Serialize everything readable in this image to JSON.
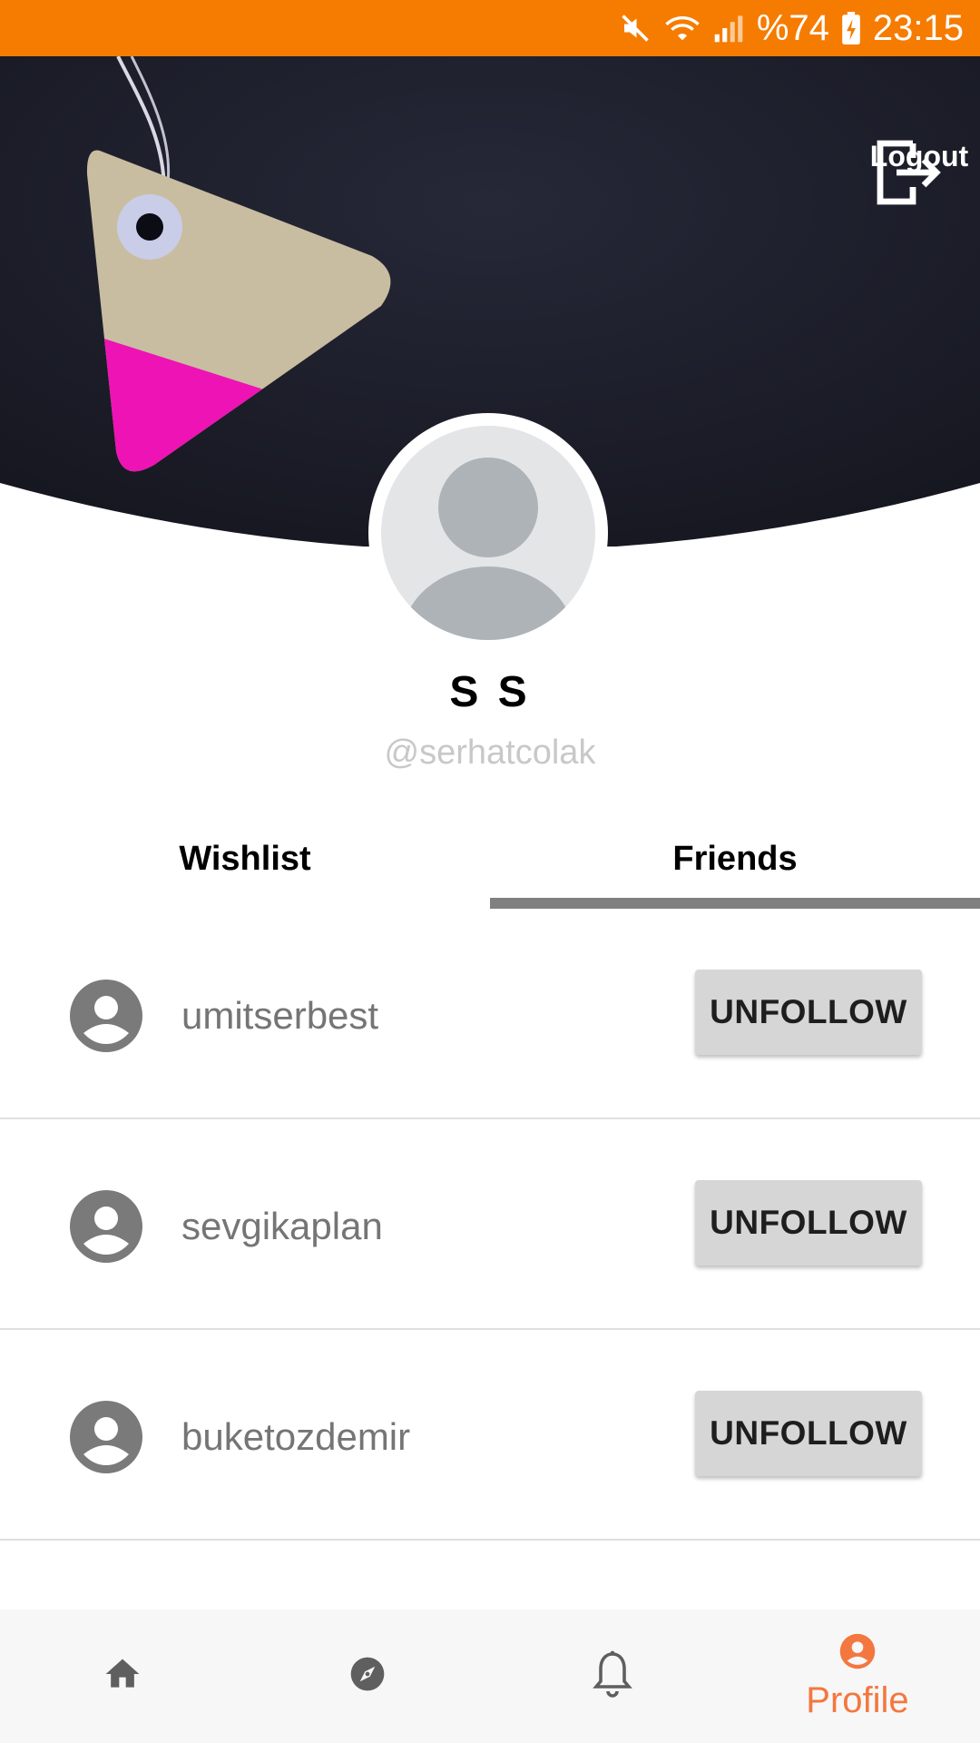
{
  "status_bar": {
    "icons": [
      "mute-icon",
      "wifi-icon",
      "signal-icon",
      "battery-charging-icon"
    ],
    "battery": "%74",
    "time": "23:15",
    "background_color": "#f57c00"
  },
  "header": {
    "logout_label": "Logout",
    "logout_icon": "logout-icon",
    "background_color": "#1b1d2a"
  },
  "profile": {
    "avatar_icon": "default-avatar-icon",
    "name": "S S",
    "handle": "@serhatcolak"
  },
  "tabs": [
    {
      "label": "Wishlist",
      "active": false
    },
    {
      "label": "Friends",
      "active": true
    }
  ],
  "friends": [
    {
      "username": "umitserbest",
      "action_label": "UNFOLLOW",
      "icon": "user-circle-icon"
    },
    {
      "username": "sevgikaplan",
      "action_label": "UNFOLLOW",
      "icon": "user-circle-icon"
    },
    {
      "username": "buketozdemir",
      "action_label": "UNFOLLOW",
      "icon": "user-circle-icon"
    }
  ],
  "bottom_nav": {
    "items": [
      {
        "icon": "home-icon",
        "label": "",
        "active": false
      },
      {
        "icon": "compass-icon",
        "label": "",
        "active": false
      },
      {
        "icon": "bell-icon",
        "label": "",
        "active": false
      },
      {
        "icon": "profile-icon",
        "label": "Profile",
        "active": true
      }
    ],
    "active_color": "#f4773f"
  }
}
